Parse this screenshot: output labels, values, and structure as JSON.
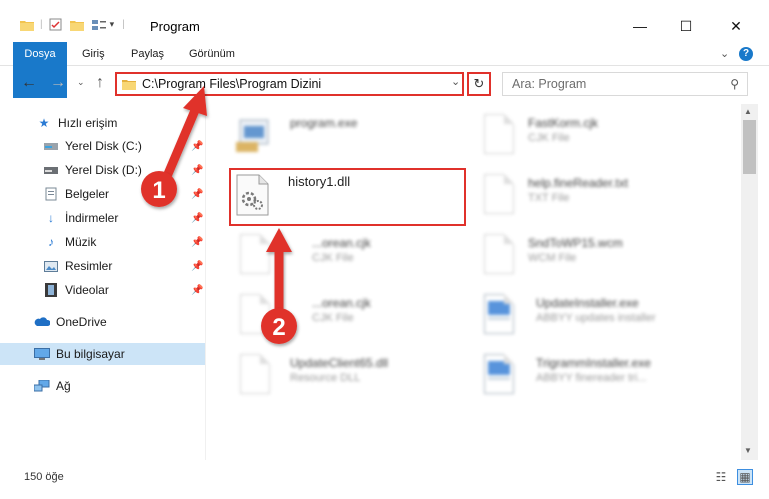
{
  "window": {
    "title": "Program",
    "minimize": "—",
    "maximize": "☐",
    "close": "✕"
  },
  "ribbon": {
    "tabs": [
      "Dosya",
      "Giriş",
      "Paylaş",
      "Görünüm"
    ],
    "collapse": "⌄",
    "help": "?"
  },
  "address": {
    "path": "C:\\Program Files\\Program Dizini"
  },
  "search": {
    "placeholder": "Ara: Program"
  },
  "sidebar": {
    "items": [
      {
        "label": "Hızlı erişim",
        "icon": "star-icon"
      },
      {
        "label": "Yerel Disk (C:)",
        "icon": "drive-icon"
      },
      {
        "label": "Yerel Disk (D:)",
        "icon": "drive-icon"
      },
      {
        "label": "Belgeler",
        "icon": "documents-icon"
      },
      {
        "label": "İndirmeler",
        "icon": "download-icon"
      },
      {
        "label": "Müzik",
        "icon": "music-icon"
      },
      {
        "label": "Resimler",
        "icon": "pictures-icon"
      },
      {
        "label": "Videolar",
        "icon": "video-icon"
      },
      {
        "label": "OneDrive",
        "icon": "cloud-icon"
      },
      {
        "label": "Bu bilgisayar",
        "icon": "computer-icon"
      },
      {
        "label": "Ağ",
        "icon": "network-icon"
      }
    ]
  },
  "files": {
    "left": [
      {
        "name": "program.exe",
        "type": ""
      },
      {
        "name": "history1.dll",
        "type": ""
      },
      {
        "name": "...orean.cjk",
        "type": "CJK File"
      },
      {
        "name": "...orean.cjk",
        "type": "CJK File"
      },
      {
        "name": "UpdateClient65.dll",
        "type": "Resource DLL"
      }
    ],
    "right": [
      {
        "name": "FastKorm.cjk",
        "type": "CJK File"
      },
      {
        "name": "help.fineReader.txt",
        "type": "TXT File"
      },
      {
        "name": "SndToWP15.wcm",
        "type": "WCM File"
      },
      {
        "name": "UpdateInstaller.exe",
        "type": "ABBYY updates installer"
      },
      {
        "name": "TrigrammInstaller.exe",
        "type": "ABBYY finereader tri..."
      }
    ]
  },
  "status": {
    "count": "150 öğe"
  },
  "annotations": {
    "step1": "1",
    "step2": "2",
    "color": "#e0312b"
  }
}
